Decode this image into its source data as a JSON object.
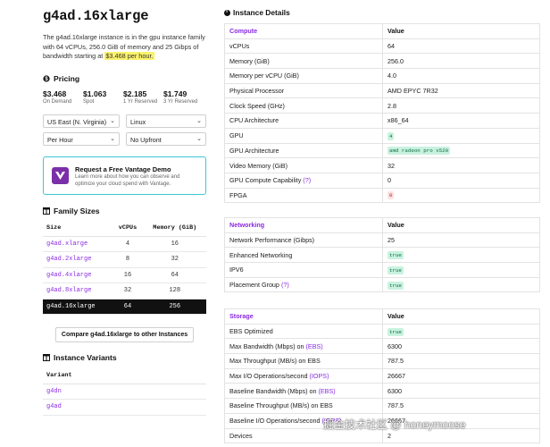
{
  "header": {
    "title": "g4ad.16xlarge",
    "description_prefix": "The g4ad.16xlarge instance is in the gpu instance family with 64 vCPUs, 256.0 GiB of memory and 25 Gibps of bandwidth starting at ",
    "description_highlight": "$3.468 per hour."
  },
  "pricing": {
    "heading": "Pricing",
    "items": [
      {
        "value": "$3.468",
        "label": "On Demand"
      },
      {
        "value": "$1.063",
        "label": "Spot"
      },
      {
        "value": "$2.185",
        "label": "1 Yr Reserved"
      },
      {
        "value": "$1.749",
        "label": "3 Yr Reserved"
      }
    ],
    "selects": {
      "region": "US East (N. Virginia)",
      "os": "Linux",
      "period": "Per Hour",
      "upfront": "No Upfront"
    }
  },
  "demo": {
    "title": "Request a Free Vantage Demo",
    "subtitle": "Learn more about how you can observe and optimize your cloud spend with Vantage."
  },
  "family": {
    "heading": "Family Sizes",
    "columns": [
      "Size",
      "vCPUs",
      "Memory (GiB)"
    ],
    "rows": [
      {
        "size": "g4ad.xlarge",
        "vcpus": "4",
        "memory": "16"
      },
      {
        "size": "g4ad.2xlarge",
        "vcpus": "8",
        "memory": "32"
      },
      {
        "size": "g4ad.4xlarge",
        "vcpus": "16",
        "memory": "64"
      },
      {
        "size": "g4ad.8xlarge",
        "vcpus": "32",
        "memory": "128"
      },
      {
        "size": "g4ad.16xlarge",
        "vcpus": "64",
        "memory": "256"
      }
    ],
    "compare_button": "Compare g4ad.16xlarge to other Instances"
  },
  "variants": {
    "heading": "Instance Variants",
    "column": "Variant",
    "rows": [
      "g4dn",
      "g4ad"
    ]
  },
  "details": {
    "heading": "Instance Details",
    "compute": {
      "header": [
        "Compute",
        "Value"
      ],
      "rows": [
        {
          "k": "vCPUs",
          "v": "64"
        },
        {
          "k": "Memory (GiB)",
          "v": "256.0"
        },
        {
          "k": "Memory per vCPU (GiB)",
          "v": "4.0"
        },
        {
          "k": "Physical Processor",
          "v": "AMD EPYC 7R32"
        },
        {
          "k": "Clock Speed (GHz)",
          "v": "2.8"
        },
        {
          "k": "CPU Architecture",
          "v": "x86_64"
        },
        {
          "k": "GPU",
          "v": "4",
          "badge": "green"
        },
        {
          "k": "GPU Architecture",
          "v": "amd radeon pro v520",
          "badge": "green"
        },
        {
          "k": "Video Memory (GiB)",
          "v": "32"
        },
        {
          "k": "GPU Compute Capability",
          "link": "(?)",
          "v": "0"
        },
        {
          "k": "FPGA",
          "v": "0",
          "badge": "red"
        }
      ]
    },
    "networking": {
      "header": [
        "Networking",
        "Value"
      ],
      "rows": [
        {
          "k": "Network Performance (Gibps)",
          "v": "25"
        },
        {
          "k": "Enhanced Networking",
          "v": "true",
          "badge": "green"
        },
        {
          "k": "IPV6",
          "v": "true",
          "badge": "green"
        },
        {
          "k": "Placement Group",
          "link": "(?)",
          "v": "true",
          "badge": "green"
        }
      ]
    },
    "storage": {
      "header": [
        "Storage",
        "Value"
      ],
      "rows": [
        {
          "k": "EBS Optimized",
          "v": "true",
          "badge": "green"
        },
        {
          "k": "Max Bandwidth (Mbps) on",
          "link": "(EBS)",
          "v": "6300"
        },
        {
          "k": "Max Throughput (MB/s) on EBS",
          "v": "787.5"
        },
        {
          "k": "Max I/O Operations/second",
          "link": "(IOPS)",
          "v": "26667"
        },
        {
          "k": "Baseline Bandwidth (Mbps) on",
          "link": "(EBS)",
          "v": "6300"
        },
        {
          "k": "Baseline Throughput (MB/s) on EBS",
          "v": "787.5"
        },
        {
          "k": "Baseline I/O Operations/second",
          "link": "(IOPS)",
          "v": "26667"
        },
        {
          "k": "Devices",
          "v": "2"
        }
      ]
    }
  },
  "watermark": "掘金技术社区 @ honeymoose",
  "colors": {
    "accent": "#8a2be2",
    "highlight": "#fbf26b",
    "demo_border": "#3fc6d1",
    "selected_row": "#111111"
  }
}
